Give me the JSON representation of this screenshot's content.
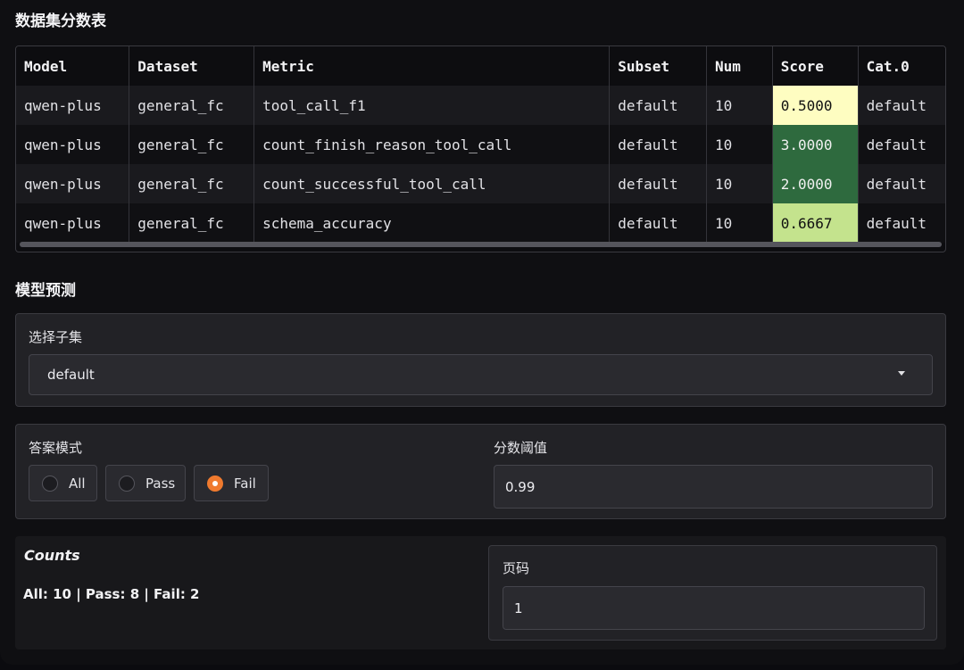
{
  "scores_title": "数据集分数表",
  "table": {
    "headers": [
      "Model",
      "Dataset",
      "Metric",
      "Subset",
      "Num",
      "Score",
      "Cat.0"
    ],
    "rows": [
      {
        "model": "qwen-plus",
        "dataset": "general_fc",
        "metric": "tool_call_f1",
        "subset": "default",
        "num": "10",
        "score": "0.5000",
        "cat": "default",
        "score_bg": "#fefdc1",
        "score_fg": "#111111"
      },
      {
        "model": "qwen-plus",
        "dataset": "general_fc",
        "metric": "count_finish_reason_tool_call",
        "subset": "default",
        "num": "10",
        "score": "3.0000",
        "cat": "default",
        "score_bg": "#2e6a3e",
        "score_fg": "#f0f0f0"
      },
      {
        "model": "qwen-plus",
        "dataset": "general_fc",
        "metric": "count_successful_tool_call",
        "subset": "default",
        "num": "10",
        "score": "2.0000",
        "cat": "default",
        "score_bg": "#2e6a3e",
        "score_fg": "#f0f0f0"
      },
      {
        "model": "qwen-plus",
        "dataset": "general_fc",
        "metric": "schema_accuracy",
        "subset": "default",
        "num": "10",
        "score": "0.6667",
        "cat": "default",
        "score_bg": "#c4e38d",
        "score_fg": "#111111"
      }
    ]
  },
  "prediction_title": "模型预测",
  "subset": {
    "label": "选择子集",
    "value": "default"
  },
  "answer_mode": {
    "label": "答案模式",
    "options": [
      {
        "label": "All",
        "selected": false
      },
      {
        "label": "Pass",
        "selected": false
      },
      {
        "label": "Fail",
        "selected": true
      }
    ]
  },
  "threshold": {
    "label": "分数阈值",
    "value": "0.99"
  },
  "counts": {
    "title": "Counts",
    "text": "All: 10 | Pass: 8 | Fail: 2"
  },
  "page": {
    "label": "页码",
    "value": "1"
  },
  "colors": {
    "accent": "#f07a2e"
  }
}
